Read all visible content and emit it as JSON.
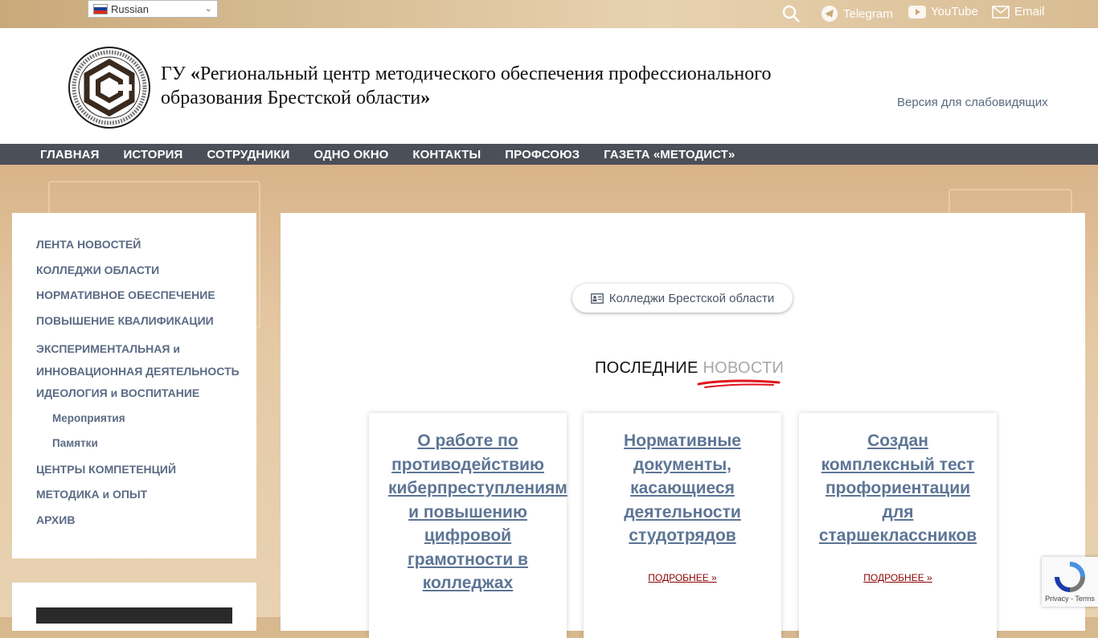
{
  "topbar": {
    "language": "Russian",
    "links": [
      {
        "label": "Telegram",
        "icon": "telegram-icon"
      },
      {
        "label": "YouTube",
        "icon": "youtube-icon"
      },
      {
        "label": "Email",
        "icon": "email-icon"
      }
    ]
  },
  "header": {
    "title_prefix": "ГУ ",
    "title_open": "«",
    "title_main": "Региональный центр методического обеспечения профессионального образования Брестской области",
    "title_close": "»",
    "low_vision": "Версия для слабовидящих"
  },
  "nav": [
    "ГЛАВНАЯ",
    "ИСТОРИЯ",
    "СОТРУДНИКИ",
    "ОДНО ОКНО",
    "КОНТАКТЫ",
    "ПРОФСОЮЗ",
    "ГАЗЕТА «МЕТОДИСТ»"
  ],
  "sidebar": {
    "items": [
      {
        "label": "ЛЕНТА НОВОСТЕЙ"
      },
      {
        "label": "КОЛЛЕДЖИ ОБЛАСТИ"
      },
      {
        "label": "НОРМАТИВНОЕ ОБЕСПЕЧЕНИЕ"
      },
      {
        "label": "ПОВЫШЕНИЕ КВАЛИФИКАЦИИ"
      },
      {
        "label": "ЭКСПЕРИМЕНТАЛЬНАЯ и ИННОВАЦИОННАЯ ДЕЯТЕЛЬНОСТЬ"
      },
      {
        "label": "ИДЕОЛОГИЯ и ВОСПИТАНИЕ"
      },
      {
        "label": "Мероприятия"
      },
      {
        "label": "Памятки"
      },
      {
        "label": "ЦЕНТРЫ КОМПЕТЕНЦИЙ"
      },
      {
        "label": "МЕТОДИКА и ОПЫТ"
      },
      {
        "label": "АРХИВ"
      }
    ]
  },
  "main": {
    "pill_label": "Колледжи Брестской области",
    "section_title_dark": "ПОСЛЕДНИЕ ",
    "section_title_light": "НОВОСТИ",
    "cards": [
      {
        "title": "О работе по противодействию киберпреступлениям и повышению цифровой грамотности в колледжах",
        "more": ""
      },
      {
        "title": "Нормативные документы, касающиеся деятельности студотрядов",
        "more": "ПОДРОБНЕЕ »"
      },
      {
        "title": "Создан комплексный тест профориентации для старшеклассников",
        "more": "ПОДРОБНЕЕ »"
      }
    ]
  },
  "recaptcha": {
    "text": "Privacy - Terms"
  },
  "colors": {
    "nav_bg": "#4b4f57",
    "link": "#5d7595",
    "more": "#8b0000",
    "accent_red": "#e0141e"
  }
}
